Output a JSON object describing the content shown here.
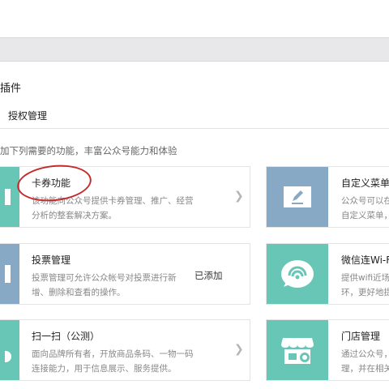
{
  "header": {
    "page_title": "插件",
    "tab_label": "授权管理",
    "description": "加下列需要的功能，丰富公众号能力和体验"
  },
  "plugins_left": [
    {
      "name": "卡券功能",
      "lines": [
        "该功能向公众号提供卡券管理、推广、经营",
        "分析的整套解决方案。"
      ],
      "status": ""
    },
    {
      "name": "投票管理",
      "lines": [
        "投票管理可允许公众帐号对投票进行新",
        "增、删除和查看的操作。"
      ],
      "status": "已添加"
    },
    {
      "name": "扫一扫（公测）",
      "lines": [
        "面向品牌所有者，开放商品条码、一物一码",
        "连接能力，用于信息展示、服务提供。"
      ],
      "status": ""
    }
  ],
  "plugins_right": [
    {
      "name": "自定义菜单",
      "lines": [
        "公众号可以在",
        "自定义菜单，"
      ]
    },
    {
      "name": "微信连Wi-Fi",
      "lines": [
        "提供wifi近场服",
        "环，更好地提"
      ]
    },
    {
      "name": "门店管理",
      "lines": [
        "通过公众号，",
        "理，并在相关"
      ]
    }
  ],
  "colors": {
    "teal_icon_bg": "#68c6b7",
    "steel_icon_bg": "#87a9c5",
    "highlight_oval": "#c62b2b"
  }
}
